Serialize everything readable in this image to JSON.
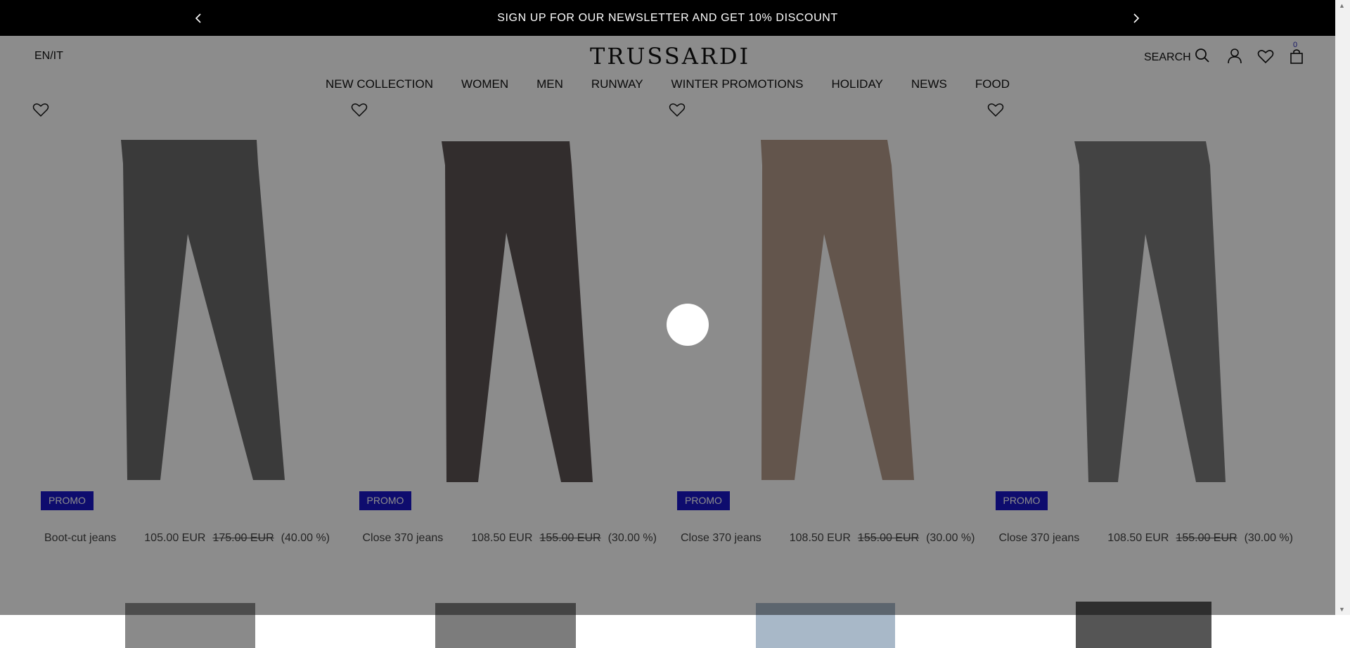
{
  "announcement": {
    "text": "SIGN UP FOR OUR NEWSLETTER AND GET 10% DISCOUNT",
    "prev_icon": "chevron-left-icon",
    "next_icon": "chevron-right-icon"
  },
  "header": {
    "language": "EN/IT",
    "brand": "TRUSSARDI",
    "search_label": "SEARCH",
    "cart_count": "0",
    "nav": [
      "NEW COLLECTION",
      "WOMEN",
      "MEN",
      "RUNWAY",
      "WINTER PROMOTIONS",
      "HOLIDAY",
      "NEWS",
      "FOOD"
    ]
  },
  "products": [
    {
      "badge": "PROMO",
      "name": "Boot-cut jeans",
      "price": "105.00 EUR",
      "old_price": "175.00 EUR",
      "discount": "(40.00 %)",
      "color": "#6a6a6a"
    },
    {
      "badge": "PROMO",
      "name": "Close 370 jeans",
      "price": "108.50 EUR",
      "old_price": "155.00 EUR",
      "discount": "(30.00 %)",
      "color": "#5c5353"
    },
    {
      "badge": "PROMO",
      "name": "Close 370 jeans",
      "price": "108.50 EUR",
      "old_price": "155.00 EUR",
      "discount": "(30.00 %)",
      "color": "#b49c8a"
    },
    {
      "badge": "PROMO",
      "name": "Close 370 jeans",
      "price": "108.50 EUR",
      "old_price": "155.00 EUR",
      "discount": "(30.00 %)",
      "color": "#7a7a7a"
    }
  ],
  "colors": {
    "promo_badge": "#1a16c9",
    "overlay": "rgba(0,0,0,0.45)"
  }
}
